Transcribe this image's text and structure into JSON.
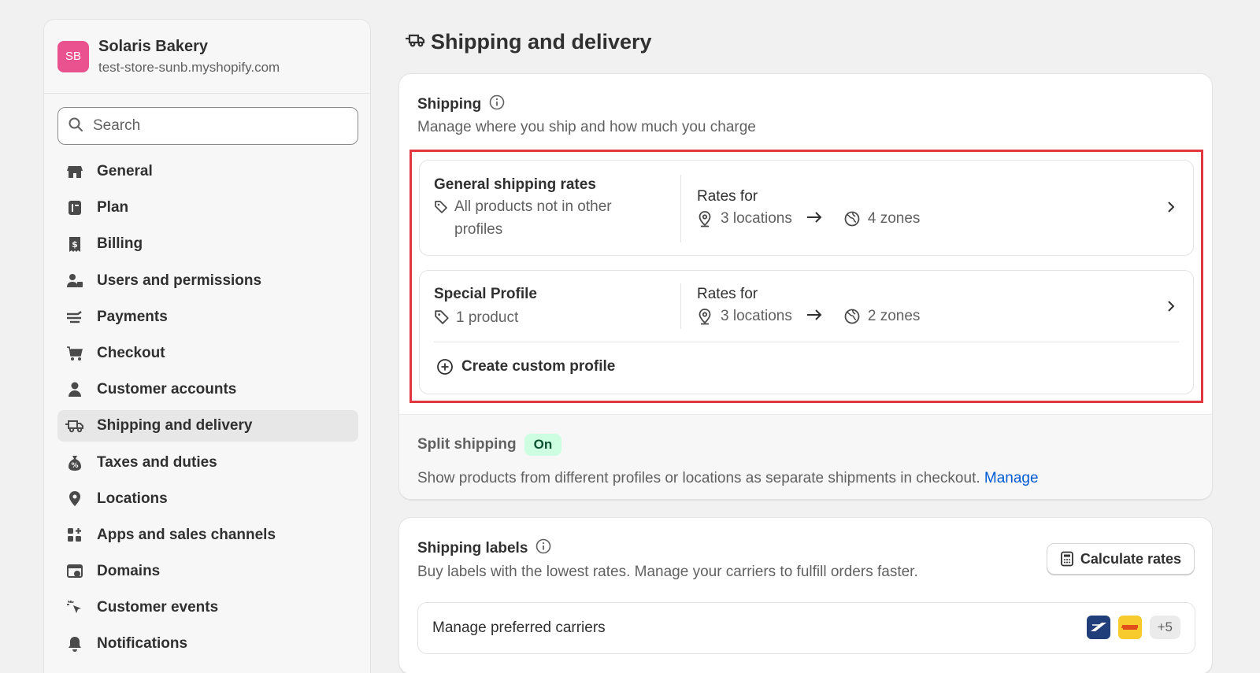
{
  "store": {
    "initials": "SB",
    "name": "Solaris Bakery",
    "url": "test-store-sunb.myshopify.com",
    "avatar_color": "#e9518f"
  },
  "search": {
    "placeholder": "Search",
    "icon": "search-icon"
  },
  "sidebar": {
    "items": [
      {
        "label": "General",
        "icon": "store-icon"
      },
      {
        "label": "Plan",
        "icon": "plan-icon"
      },
      {
        "label": "Billing",
        "icon": "receipt-dollar-icon"
      },
      {
        "label": "Users and permissions",
        "icon": "users-icon"
      },
      {
        "label": "Payments",
        "icon": "payments-icon"
      },
      {
        "label": "Checkout",
        "icon": "cart-icon"
      },
      {
        "label": "Customer accounts",
        "icon": "person-icon"
      },
      {
        "label": "Shipping and delivery",
        "icon": "truck-icon",
        "active": true
      },
      {
        "label": "Taxes and duties",
        "icon": "tax-icon"
      },
      {
        "label": "Locations",
        "icon": "location-icon"
      },
      {
        "label": "Apps and sales channels",
        "icon": "apps-icon"
      },
      {
        "label": "Domains",
        "icon": "domains-icon"
      },
      {
        "label": "Customer events",
        "icon": "cursor-click-icon"
      },
      {
        "label": "Notifications",
        "icon": "bell-icon"
      }
    ]
  },
  "page": {
    "title": "Shipping and delivery"
  },
  "shipping": {
    "title": "Shipping",
    "subtitle": "Manage where you ship and how much you charge",
    "profiles": [
      {
        "name": "General shipping rates",
        "desc_line1": "All products not in other",
        "desc_line2": "profiles",
        "rates_for": "Rates for",
        "locations": "3 locations",
        "zones": "4 zones"
      },
      {
        "name": "Special Profile",
        "desc_line1": "1 product",
        "rates_for": "Rates for",
        "locations": "3 locations",
        "zones": "2 zones"
      }
    ],
    "create_label": "Create custom profile"
  },
  "split": {
    "title": "Split shipping",
    "badge": "On",
    "description": "Show products from different profiles or locations as separate shipments in checkout.",
    "link": "Manage"
  },
  "labels": {
    "title": "Shipping labels",
    "subtitle": "Buy labels with the lowest rates. Manage your carriers to fulfill orders faster.",
    "button": "Calculate rates",
    "carriers_label": "Manage preferred carriers",
    "carrier_logos": [
      "usps-logo-icon",
      "dhl-logo-icon"
    ],
    "more_carriers": "+5"
  },
  "colors": {
    "highlight": "#e0383e",
    "link": "#005bd3",
    "badge_bg": "#cdfee1"
  }
}
